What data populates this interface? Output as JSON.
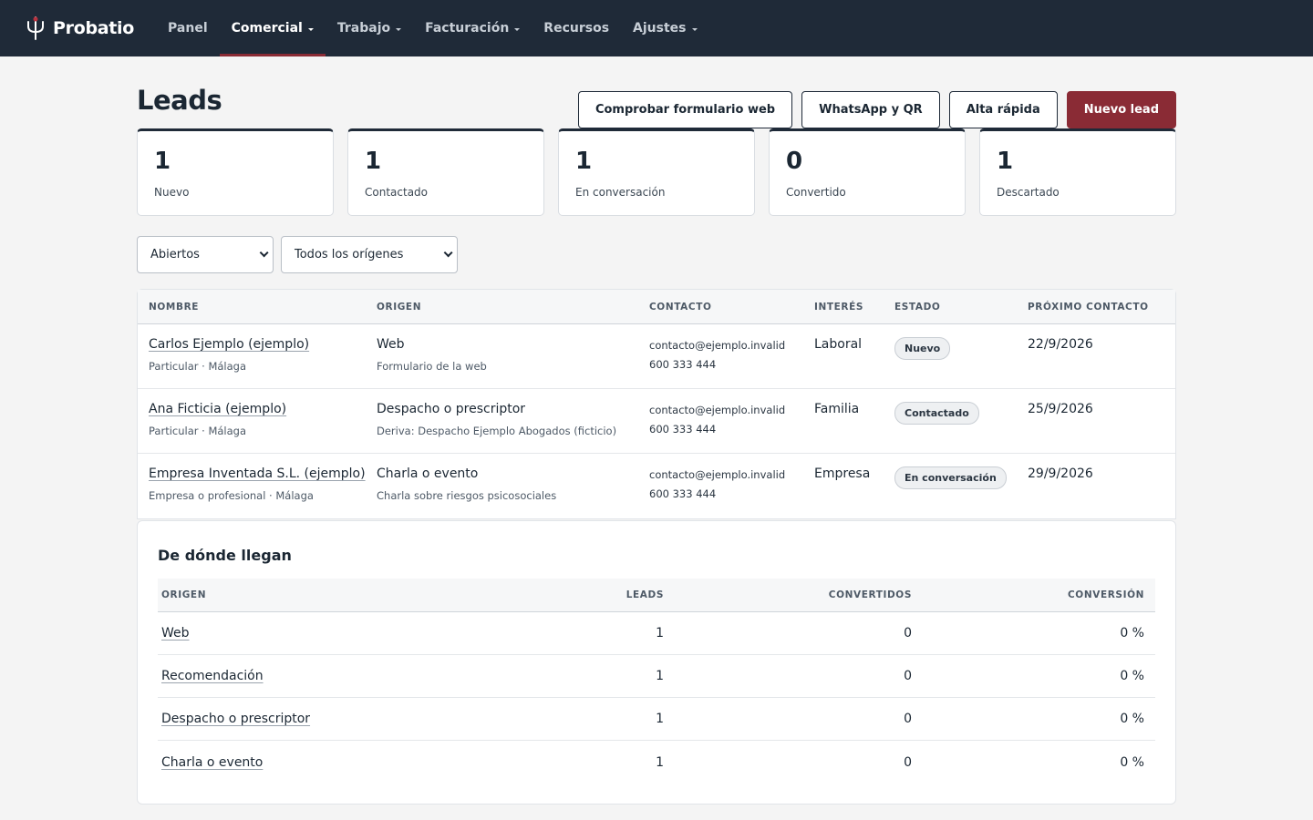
{
  "app": {
    "name": "Probatio",
    "logo_icon": "trident-icon"
  },
  "nav": {
    "items": [
      {
        "label": "Panel",
        "dropdown": false,
        "active": false
      },
      {
        "label": "Comercial",
        "dropdown": true,
        "active": true
      },
      {
        "label": "Trabajo",
        "dropdown": true,
        "active": false
      },
      {
        "label": "Facturación",
        "dropdown": true,
        "active": false
      },
      {
        "label": "Recursos",
        "dropdown": false,
        "active": false
      },
      {
        "label": "Ajustes",
        "dropdown": true,
        "active": false
      }
    ],
    "active_color": "#8a2b35"
  },
  "page": {
    "title": "Leads"
  },
  "actions": {
    "check_form": "Comprobar formulario web",
    "whatsapp_qr": "WhatsApp y QR",
    "quick_add": "Alta rápida",
    "new_lead": "Nuevo lead"
  },
  "stats": [
    {
      "value": "1",
      "label": "Nuevo"
    },
    {
      "value": "1",
      "label": "Contactado"
    },
    {
      "value": "1",
      "label": "En conversación"
    },
    {
      "value": "0",
      "label": "Convertido"
    },
    {
      "value": "1",
      "label": "Descartado"
    }
  ],
  "filters": {
    "status": "Abiertos",
    "origin": "Todos los orígenes"
  },
  "leads_table": {
    "headers": {
      "name": "NOMBRE",
      "origin": "ORIGEN",
      "contact": "CONTACTO",
      "interest": "INTERÉS",
      "status": "ESTADO",
      "next": "PRÓXIMO CONTACTO"
    },
    "rows": [
      {
        "name": "Carlos Ejemplo (ejemplo)",
        "name_sub": "Particular · Málaga",
        "origin": "Web",
        "origin_sub": "Formulario de la web",
        "email": "contacto@ejemplo.invalid",
        "phone": "600 333 444",
        "interest": "Laboral",
        "status": "Nuevo",
        "next": "22/9/2026"
      },
      {
        "name": "Ana Ficticia (ejemplo)",
        "name_sub": "Particular · Málaga",
        "origin": "Despacho o prescriptor",
        "origin_sub": "Deriva: Despacho Ejemplo Abogados (ficticio)",
        "email": "contacto@ejemplo.invalid",
        "phone": "600 333 444",
        "interest": "Familia",
        "status": "Contactado",
        "next": "25/9/2026"
      },
      {
        "name": "Empresa Inventada S.L. (ejemplo)",
        "name_sub": "Empresa o profesional · Málaga",
        "origin": "Charla o evento",
        "origin_sub": "Charla sobre riesgos psicosociales",
        "email": "contacto@ejemplo.invalid",
        "phone": "600 333 444",
        "interest": "Empresa",
        "status": "En conversación",
        "next": "29/9/2026"
      }
    ]
  },
  "origins": {
    "title": "De dónde llegan",
    "headers": {
      "origin": "ORIGEN",
      "leads": "LEADS",
      "converted": "CONVERTIDOS",
      "conversion": "CONVERSIÓN"
    },
    "rows": [
      {
        "origin": "Web",
        "leads": "1",
        "converted": "0",
        "conversion": "0 %"
      },
      {
        "origin": "Recomendación",
        "leads": "1",
        "converted": "0",
        "conversion": "0 %"
      },
      {
        "origin": "Despacho o prescriptor",
        "leads": "1",
        "converted": "0",
        "conversion": "0 %"
      },
      {
        "origin": "Charla o evento",
        "leads": "1",
        "converted": "0",
        "conversion": "0 %"
      }
    ]
  }
}
